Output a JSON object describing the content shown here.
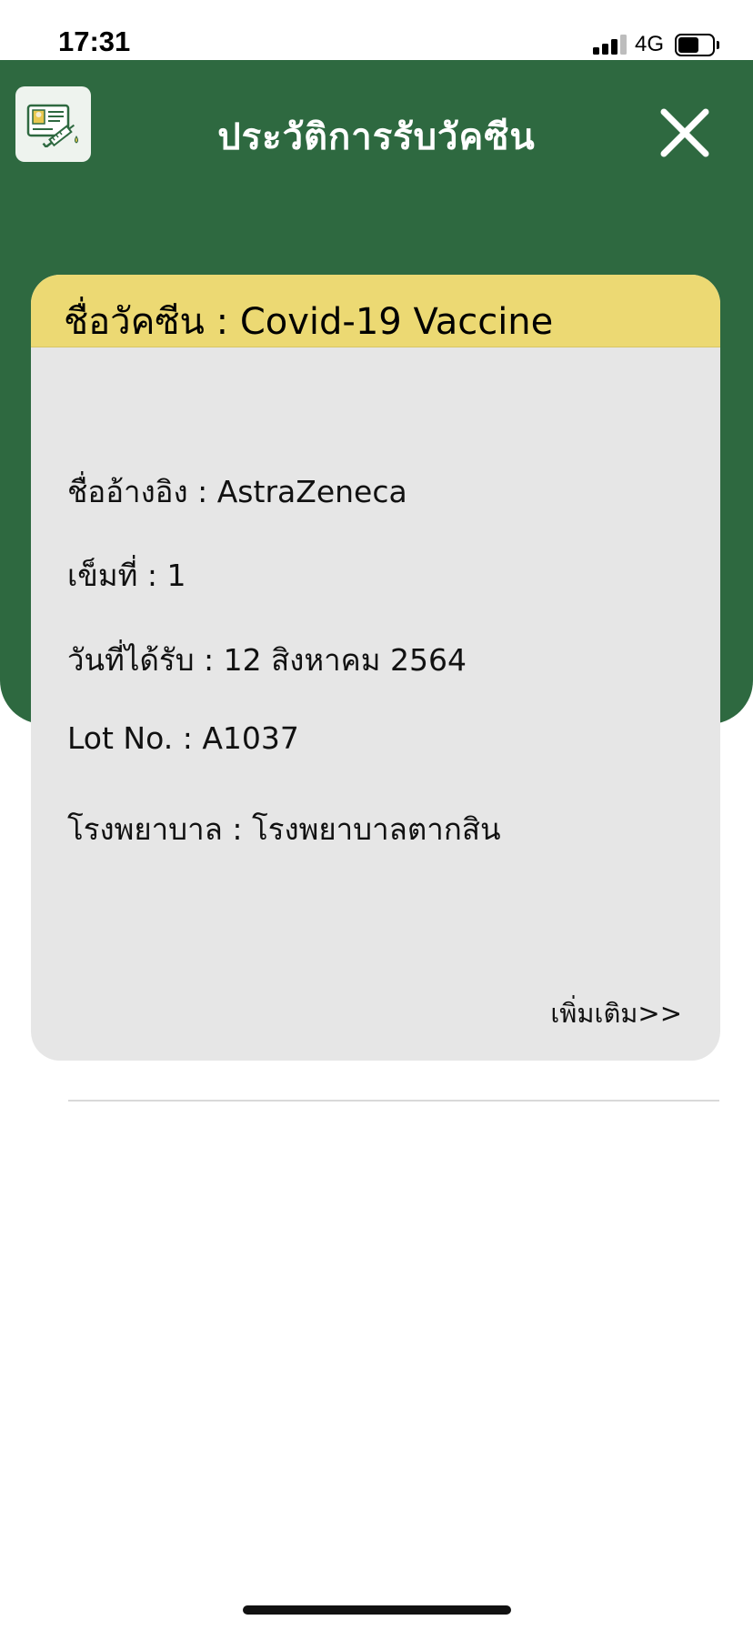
{
  "status_bar": {
    "time": "17:31",
    "network": "4G",
    "signal_bars": 3,
    "battery_level": 0.6
  },
  "header": {
    "title": "ประวัติการรับวัคซีน",
    "app_icon": "vaccine-certificate-icon",
    "close_icon": "close-icon",
    "background_color": "#2e6940"
  },
  "card": {
    "title_label": "ชื่อวัคซีน",
    "title_value": "Covid-19 Vaccine",
    "header_color": "#ecd973",
    "rows": [
      {
        "label": "ชื่ออ้างอิง",
        "value": "AstraZeneca"
      },
      {
        "label": "เข็มที่",
        "value": "1"
      },
      {
        "label": "วันที่ได้รับ",
        "value": "12 สิงหาคม 2564"
      },
      {
        "label": "Lot No.",
        "value": "A1037"
      },
      {
        "label": "โรงพยาบาล",
        "value": "โรงพยาบาลตากสิน"
      }
    ],
    "more_label": "เพิ่มเติม>>"
  }
}
